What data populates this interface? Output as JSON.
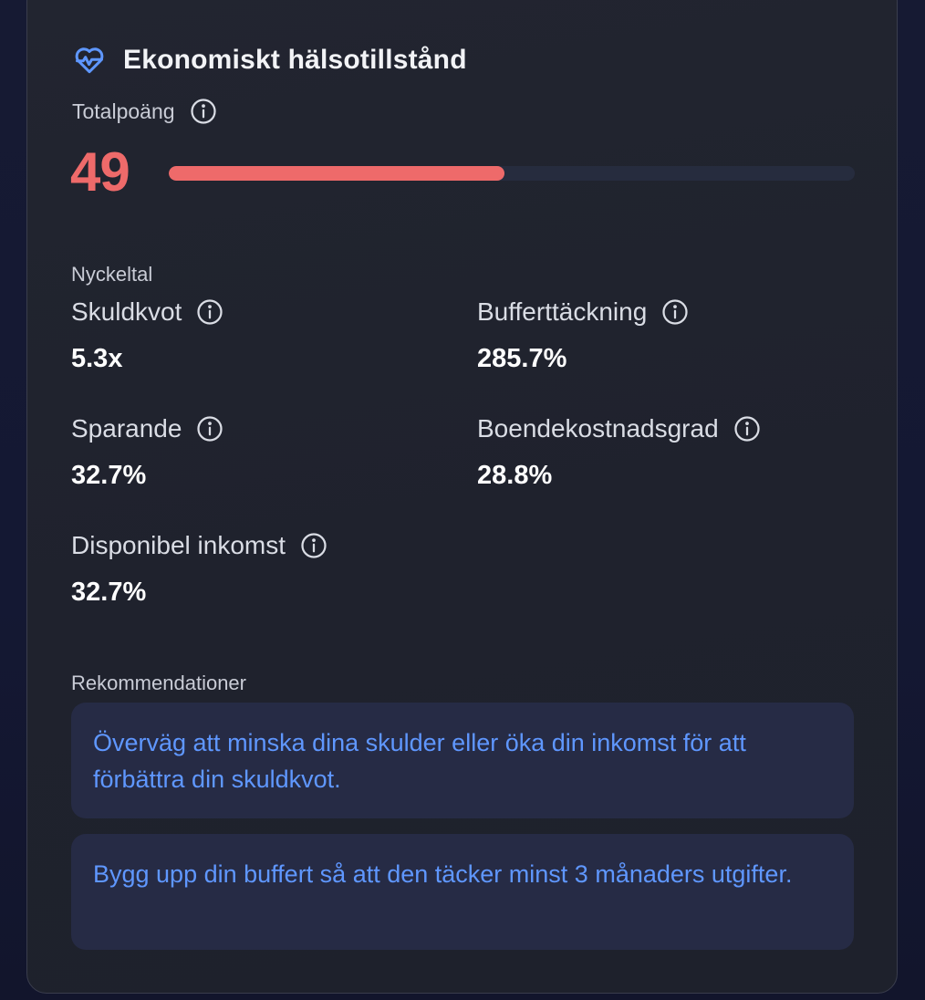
{
  "colors": {
    "accent_blue": "#5f97ff",
    "score_red": "#ee6a6a",
    "card_bg": "#20232e",
    "page_bg": "#15182d"
  },
  "header": {
    "icon": "heart-pulse-icon",
    "title": "Ekonomiskt hälsotillstånd"
  },
  "score": {
    "label": "Totalpoäng",
    "value": "49",
    "progress_percent": 49
  },
  "metrics": {
    "section_label": "Nyckeltal",
    "items": [
      {
        "name": "Skuldkvot",
        "value": "5.3x"
      },
      {
        "name": "Bufferttäckning",
        "value": "285.7%"
      },
      {
        "name": "Sparande",
        "value": "32.7%"
      },
      {
        "name": "Boendekostnadsgrad",
        "value": "28.8%"
      },
      {
        "name": "Disponibel inkomst",
        "value": "32.7%"
      }
    ]
  },
  "recommendations": {
    "section_label": "Rekommendationer",
    "items": [
      "Överväg att minska dina skulder eller öka din inkomst för att förbättra din skuldkvot.",
      "Bygg upp din buffert så att den täcker minst 3 månaders utgifter."
    ]
  }
}
